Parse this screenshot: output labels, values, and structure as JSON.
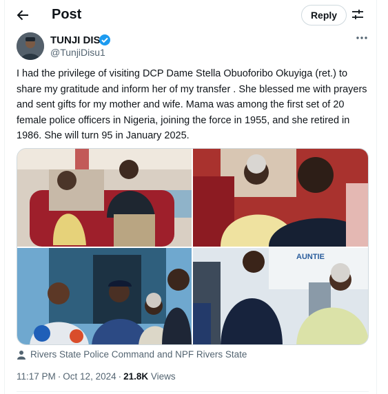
{
  "header": {
    "title": "Post",
    "reply_label": "Reply",
    "back_icon": "arrow-left-icon",
    "filter_icon": "sliders-icon"
  },
  "author": {
    "name": "TUNJI DISU",
    "handle": "@TunjiDisu1",
    "verified": true,
    "verified_color": "#1d9bf0"
  },
  "tweet": {
    "text": "I had the privilege of visiting DCP Dame Stella Obuoforibo Okuyiga (ret.) to share my gratitude and inform her of my  transfer . She blessed me with prayers and sent gifts for my mother and wife. Mama was among the first set of 20 female police officers in Nigeria, joining the force in 1955, and she retired in 1986. She will turn  95 in January 2025."
  },
  "media": {
    "sign_text": "AUNTIE"
  },
  "tagged": {
    "text": "Rivers State Police Command and NPF Rivers State"
  },
  "meta": {
    "time": "11:17 PM",
    "date": "Oct 12, 2024",
    "separator": "·",
    "views_count": "21.8K",
    "views_label": "Views"
  }
}
